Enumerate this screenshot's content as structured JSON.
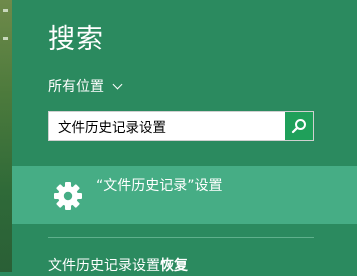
{
  "panel": {
    "title": "搜索",
    "scope_label": "所有位置",
    "accent_color": "#2b8a5f"
  },
  "search": {
    "value": "文件历史记录设置",
    "button_icon": "search-icon"
  },
  "results": [
    {
      "icon": "gear-icon",
      "label": "“文件历史记录”设置"
    }
  ],
  "suggestions": [
    {
      "prefix": "文件历史记录设置",
      "suffix": "恢复"
    }
  ]
}
